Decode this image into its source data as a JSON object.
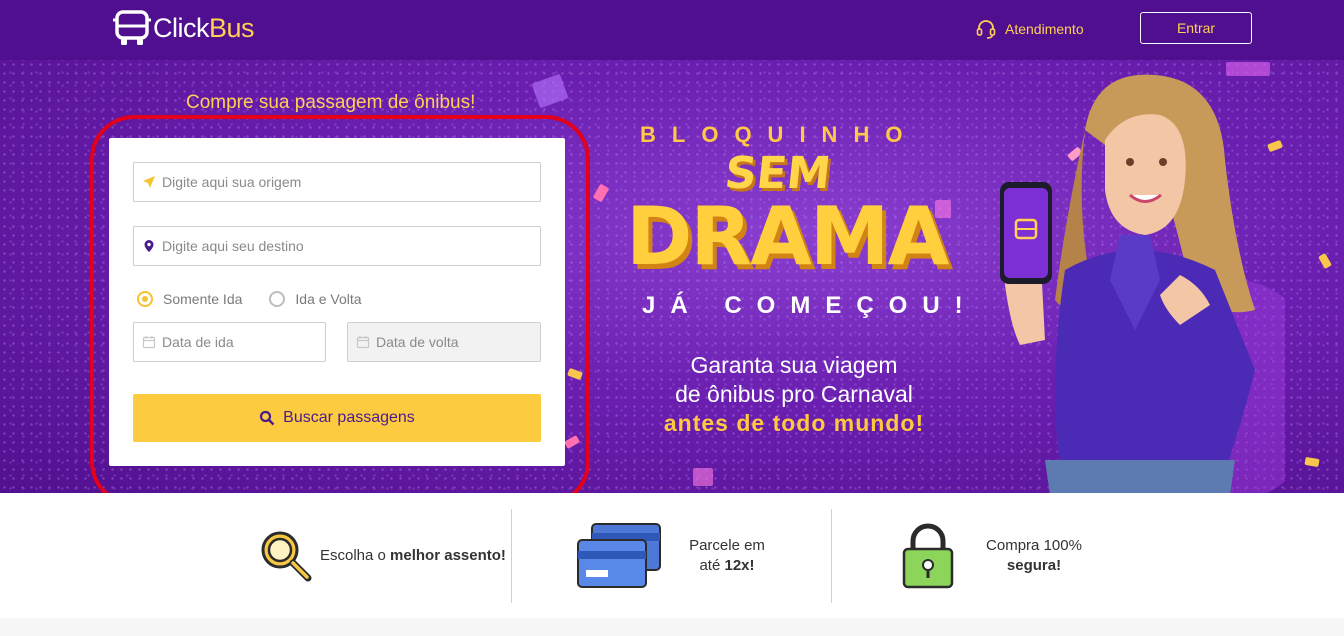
{
  "header": {
    "logo_part1": "Click",
    "logo_part2": "Bus",
    "support_label": "Atendimento",
    "login_label": "Entrar"
  },
  "hero": {
    "title": "Compre sua passagem de ônibus!",
    "origin_placeholder": "Digite aqui sua origem",
    "destination_placeholder": "Digite aqui seu destino",
    "trip_options": [
      "Somente Ida",
      "Ida e Volta"
    ],
    "selected_trip": "Somente Ida",
    "depart_placeholder": "Data de ida",
    "return_placeholder": "Data de volta",
    "search_button": "Buscar passagens"
  },
  "promo": {
    "line_top": "BLOQUINHO",
    "line_sem": "SEM",
    "line_drama": "DRAMA",
    "line_comecou": "JÁ COMEÇOU!",
    "body_1": "Garanta sua viagem",
    "body_2": "de ônibus pro Carnaval",
    "body_3": "antes de todo mundo!"
  },
  "features": [
    {
      "text": "Escolha o",
      "bold": "melhor assento!",
      "icon": "magnifier-icon"
    },
    {
      "text": "Parcele em até",
      "bold": "12x!",
      "icon": "credit-cards-icon"
    },
    {
      "text": "Compra 100%",
      "bold": "segura!",
      "icon": "padlock-icon"
    }
  ],
  "colors": {
    "header_bg": "#4f0f8e",
    "accent_yellow": "#fdcb3f",
    "highlight_red": "#e2001a"
  }
}
